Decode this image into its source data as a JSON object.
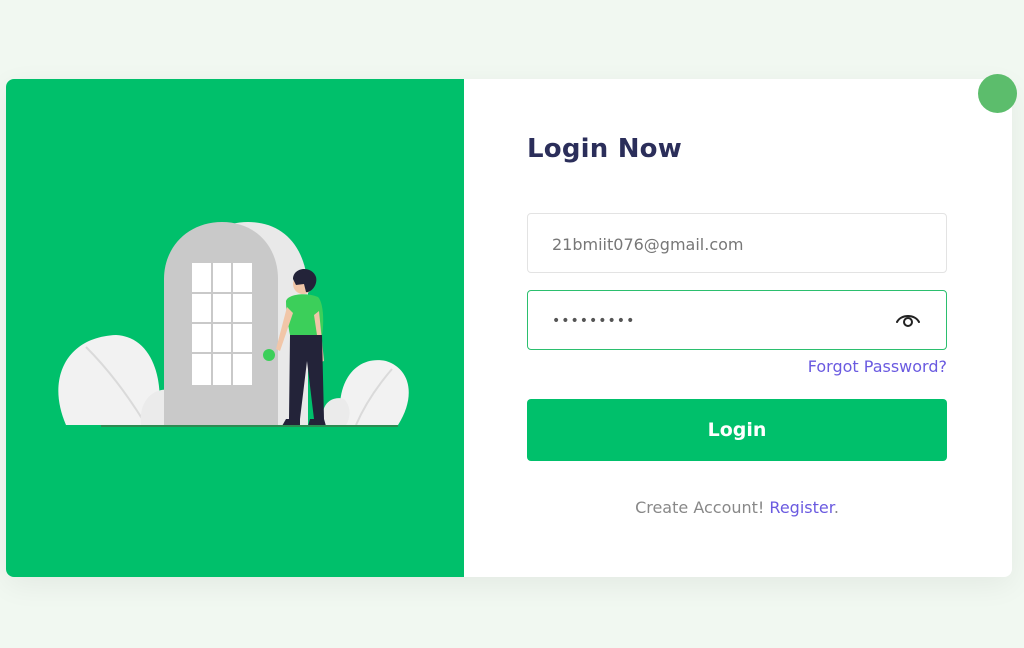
{
  "login": {
    "title": "Login Now",
    "email": {
      "value": "21bmiit076@gmail.com"
    },
    "password": {
      "value": "•••••••••"
    },
    "forgot_password": "Forgot Password?",
    "submit_label": "Login",
    "create_account_text": "Create Account!",
    "register_link": "Register",
    "register_suffix": "."
  },
  "illustration": {
    "name": "person-opening-door"
  },
  "icons": {
    "password_toggle": "eye-icon"
  },
  "colors": {
    "brand_green": "#00c06b",
    "title": "#2b2e5a",
    "link": "#6a5ae0",
    "corner_dot": "#5cbd6c",
    "page_background": "#f1f8f1"
  }
}
